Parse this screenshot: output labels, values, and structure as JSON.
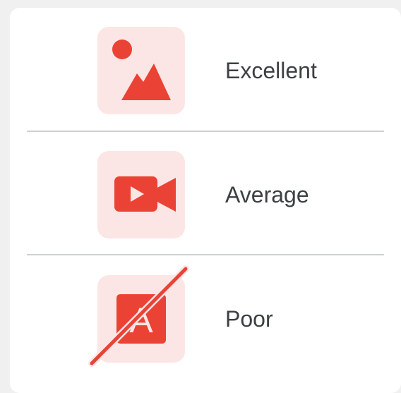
{
  "colors": {
    "accent": "#ea4335",
    "tile_background": "#fce6e5",
    "text": "#3c4043",
    "divider": "#cfd0d1",
    "card_background": "#ffffff"
  },
  "items": [
    {
      "icon": "image-icon",
      "label": "Excellent"
    },
    {
      "icon": "video-camera-icon",
      "label": "Average"
    },
    {
      "icon": "text-off-icon",
      "label": "Poor",
      "icon_glyph": "A"
    }
  ]
}
